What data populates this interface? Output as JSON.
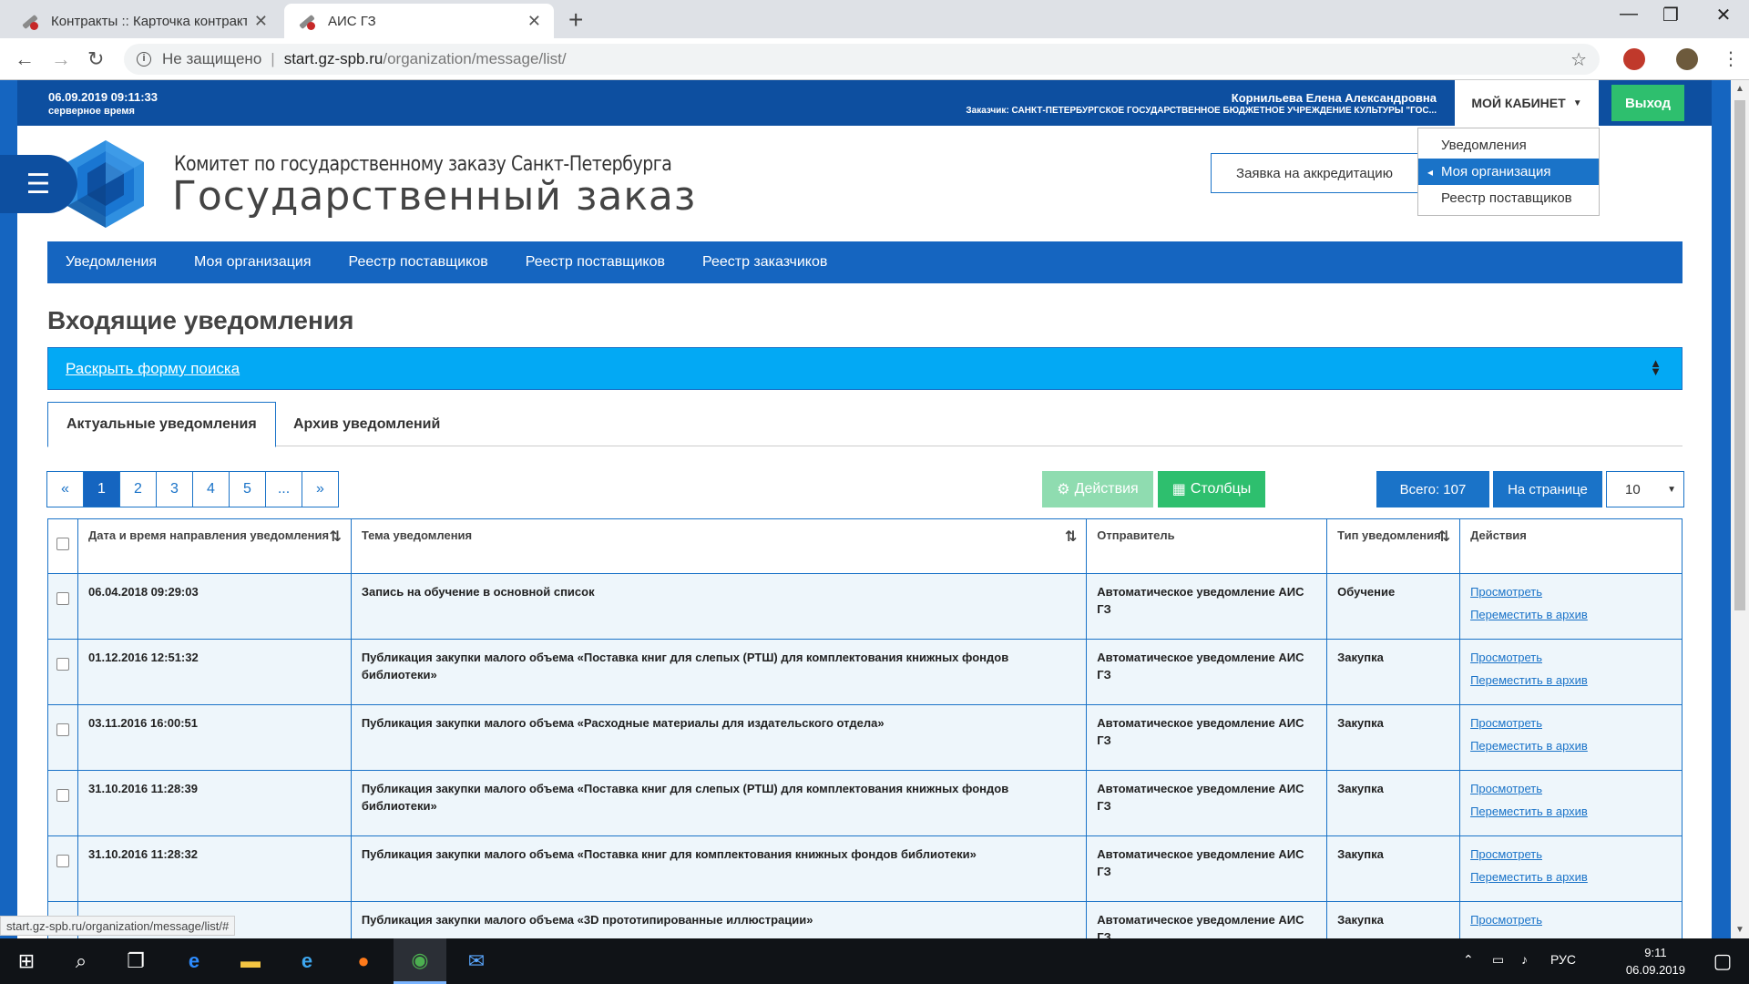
{
  "browser": {
    "tabs": [
      {
        "title": "Контракты :: Карточка контракт",
        "active": false
      },
      {
        "title": "АИС ГЗ",
        "active": true
      }
    ],
    "new_tab": "+",
    "window_controls": [
      "—",
      "❐",
      "✕"
    ],
    "insecure_label": "Не защищено",
    "url_host": "start.gz-spb.ru",
    "url_path": "/organization/message/list/",
    "status_url": "start.gz-spb.ru/organization/message/list/#"
  },
  "header": {
    "server_time": "06.09.2019 09:11:33",
    "server_label": "серверное время",
    "user_name": "Корнильева Елена Александровна",
    "customer": "Заказчик: САНКТ-ПЕТЕРБУРГСКОЕ ГОСУДАРСТВЕННОЕ БЮДЖЕТНОЕ УЧРЕЖДЕНИЕ КУЛЬТУРЫ \"ГОС...",
    "cabinet": "МОЙ КАБИНЕТ",
    "exit": "Выход"
  },
  "dropdown": {
    "items": [
      {
        "label": "Уведомления"
      },
      {
        "label": "Моя организация",
        "active": true
      },
      {
        "label": "Реестр поставщиков"
      }
    ]
  },
  "brand": {
    "org_line": "Комитет по государственному заказу Санкт-Петербурга",
    "title": "Государственный заказ",
    "accreditation": "Заявка на аккредитацию",
    "colors": {
      "primary": "#1565c0",
      "logo_light": "#2f8fe0",
      "logo_dark": "#0d4fa0"
    }
  },
  "nav": {
    "items": [
      "Уведомления",
      "Моя организация",
      "Реестр поставщиков",
      "Реестр поставщиков",
      "Реестр заказчиков"
    ]
  },
  "main": {
    "title": "Входящие уведомления",
    "search_toggle": "Раскрыть форму поиска",
    "tabs": [
      "Актуальные уведомления",
      "Архив уведомлений"
    ],
    "pager": [
      "«",
      "1",
      "2",
      "3",
      "4",
      "5",
      "...",
      "»"
    ],
    "pager_active": "1",
    "actions_btn": "Действия",
    "columns_btn": "Столбцы",
    "total": "Всего: 107",
    "per_page_label": "На странице",
    "per_page_value": "10"
  },
  "table": {
    "headers": [
      "Дата и время направления уведомления",
      "Тема уведомления",
      "Отправитель",
      "Тип уведомления",
      "Действия"
    ],
    "rows": [
      {
        "date": "06.04.2018 09:29:03",
        "subject": "Запись на обучение в основной список",
        "sender": "Автоматическое уведомление АИС ГЗ",
        "type": "Обучение"
      },
      {
        "date": "01.12.2016 12:51:32",
        "subject": "Публикация закупки малого объема «Поставка книг для слепых (РТШ) для комплектования книжных фондов библиотеки»",
        "sender": "Автоматическое уведомление АИС ГЗ",
        "type": "Закупка"
      },
      {
        "date": "03.11.2016 16:00:51",
        "subject": "Публикация закупки малого объема «Расходные материалы для издательского отдела»",
        "sender": "Автоматическое уведомление АИС ГЗ",
        "type": "Закупка"
      },
      {
        "date": "31.10.2016 11:28:39",
        "subject": "Публикация закупки малого объема «Поставка книг для слепых (РТШ) для комплектования книжных фондов библиотеки»",
        "sender": "Автоматическое уведомление АИС ГЗ",
        "type": "Закупка"
      },
      {
        "date": "31.10.2016 11:28:32",
        "subject": "Публикация закупки малого объема «Поставка книг для комплектования книжных фондов библиотеки»",
        "sender": "Автоматическое уведомление АИС ГЗ",
        "type": "Закупка"
      },
      {
        "date": "",
        "subject": "Публикация закупки малого объема «3D прототипированные иллюстрации»",
        "sender": "Автоматическое уведомление АИС ГЗ",
        "type": "Закупка"
      }
    ],
    "view_label": "Просмотреть",
    "archive_label": "Переместить в архив"
  },
  "taskbar": {
    "lang": "РУС",
    "time": "9:11",
    "date": "06.09.2019"
  }
}
